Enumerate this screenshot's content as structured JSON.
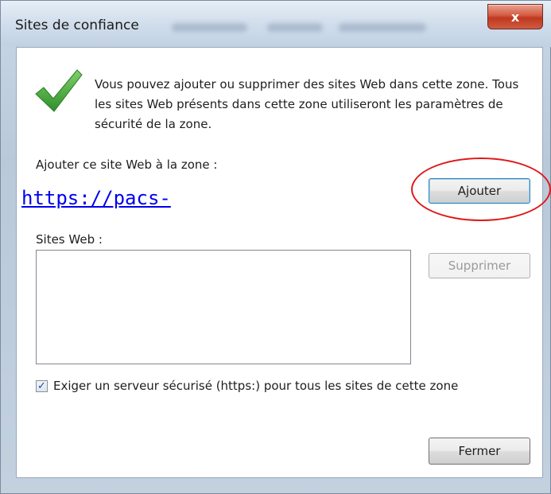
{
  "window": {
    "title": "Sites de confiance",
    "close_glyph": "x"
  },
  "dialog": {
    "intro_text": "Vous pouvez ajouter ou supprimer des sites Web dans cette zone. Tous les sites Web présents dans cette zone utiliseront les paramètres de sécurité de la zone.",
    "add_label": "Ajouter ce site Web à la zone :",
    "url_value": "https://pacs-",
    "add_button": "Ajouter",
    "sites_label": "Sites Web :",
    "sites_list": [],
    "remove_button": "Supprimer",
    "require_https_label": "Exiger un serveur sécurisé (https:) pour tous les sites de cette zone",
    "require_https_checked": true,
    "close_button": "Fermer"
  },
  "colors": {
    "highlight_ring": "#e01818",
    "link": "#0000ee",
    "check_green": "#3fa535"
  }
}
